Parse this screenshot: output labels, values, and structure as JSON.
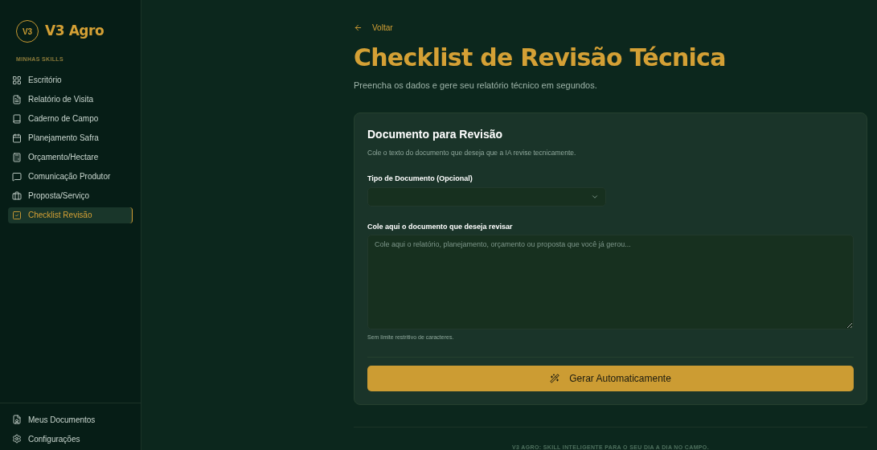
{
  "brand": {
    "logo": "V3",
    "name": "V3 Agro"
  },
  "sidebar": {
    "section": "MINHAS SKILLS",
    "items": [
      {
        "label": "Escritório",
        "selected": false
      },
      {
        "label": "Relatório de Visita",
        "selected": false
      },
      {
        "label": "Caderno de Campo",
        "selected": false
      },
      {
        "label": "Planejamento Safra",
        "selected": false
      },
      {
        "label": "Orçamento/Hectare",
        "selected": false
      },
      {
        "label": "Comunicação Produtor",
        "selected": false
      },
      {
        "label": "Proposta/Serviço",
        "selected": false
      },
      {
        "label": "Checklist Revisão",
        "selected": true
      }
    ],
    "footer_items": [
      {
        "label": "Meus Documentos"
      },
      {
        "label": "Configurações"
      }
    ]
  },
  "back_link": "Voltar",
  "title": "Checklist de Revisão Técnica",
  "subtitle": "Preencha os dados e gere seu relatório técnico em segundos.",
  "card": {
    "title": "Documento para Revisão",
    "description": "Cole o texto do documento que deseja que a IA revise tecnicamente.",
    "select_label": "Tipo de Documento (Opcional)",
    "textarea_label": "Cole aqui o documento que deseja revisar",
    "textarea_placeholder": "Cole aqui o relatório, planejamento, orçamento ou proposta que você já gerou...",
    "hint": "Sem limite restritivo de caracteres.",
    "button": "Gerar Automaticamente"
  },
  "footer": "V3 AGRO: SKILL INTELIGENTE PARA O SEU DIA A DIA NO CAMPO."
}
